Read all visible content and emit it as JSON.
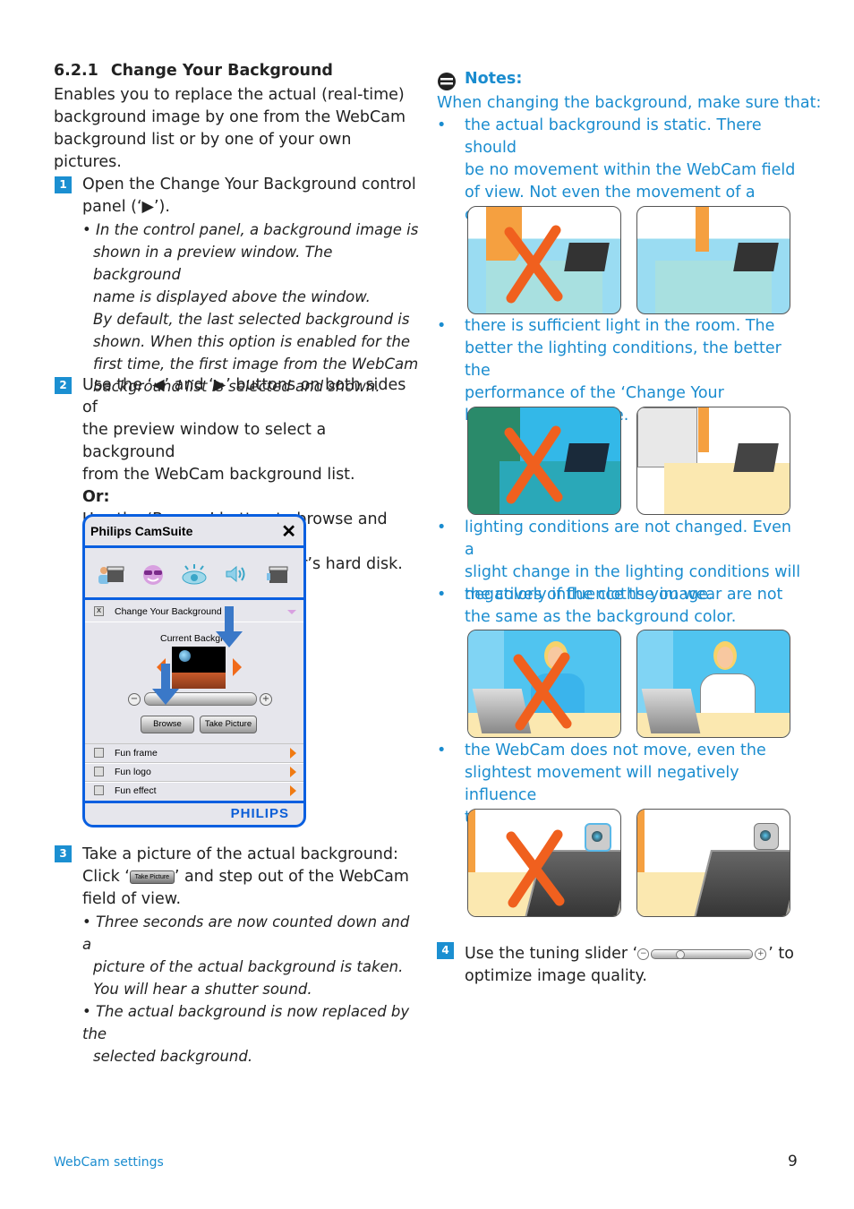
{
  "section": {
    "number": "6.2.1",
    "title": "Change Your Background",
    "intro": [
      "Enables you to replace the actual (real-time)",
      "background image by one from the WebCam",
      "background list or by one of your own pictures."
    ]
  },
  "steps": [
    {
      "number": "1",
      "lines": [
        "Open the Change Your Background control",
        "panel (‘▶’)."
      ],
      "notes": [
        "• In the control panel, a background image is",
        "shown in a preview window. The background",
        "name is displayed above the window.",
        "By default, the last selected background is",
        "shown. When this option is enabled for the",
        "first time, the first image from the WebCam",
        "background list is selected and shown."
      ]
    },
    {
      "number": "2",
      "lines": [
        "Use the ‘◀’ and ‘▶’ buttons on both sides of",
        "the preview window to select a background",
        "from the WebCam background list."
      ],
      "or_label": "Or:",
      "alt_lines": [
        "Use the ‘Browse’ button to browse and load",
        "pictures from your computer’s hard disk."
      ]
    },
    {
      "number": "3",
      "line1": "Take a picture of the actual background:",
      "line2_pre": "Click ‘",
      "line2_btn": "Take Picture",
      "line2_post": "’ and step out of the WebCam",
      "line3": "field of view.",
      "notes": [
        "• Three seconds are now counted down and a",
        "picture of the actual background is taken.",
        "You will hear a shutter sound.",
        "• The actual background is now replaced by the",
        "selected background."
      ]
    },
    {
      "number": "4",
      "pre": "Use the tuning slider ‘",
      "post": "’ to",
      "line2": "optimize image quality.",
      "slider_value_fraction": 0.25
    }
  ],
  "camsuite": {
    "title": "Philips CamSuite",
    "close_icon": "close-icon",
    "toolbar_icons": [
      "background-clapper-icon",
      "sunglasses-face-icon",
      "eye-icon",
      "speaker-icon",
      "clapper-icon"
    ],
    "section_title": "Change Your Background",
    "current_background_label": "Current Backgrou",
    "browse_label": "Browse",
    "take_picture_label": "Take Picture",
    "list": [
      {
        "label": "Fun frame"
      },
      {
        "label": "Fun logo"
      },
      {
        "label": "Fun effect"
      }
    ],
    "brand": "PHILIPS"
  },
  "notes": {
    "title": "Notes:",
    "intro": "When changing the background, make sure that:",
    "items": [
      {
        "lines": [
          "the actual background is static. There should",
          "be no movement within the WebCam field",
          "of view. Not even the movement of a",
          "curtain."
        ]
      },
      {
        "lines": [
          "there is sufficient light in the room. The",
          "better the lighting conditions, the better the",
          "performance of the ‘Change Your",
          "background’ feature."
        ]
      },
      {
        "lines": [
          "lighting conditions are not changed. Even a",
          "slight change in the lighting conditions will",
          "negatively influence the image."
        ]
      },
      {
        "lines": [
          "the colors of the cloths you wear are not",
          "the same as the background color."
        ]
      },
      {
        "lines": [
          "the WebCam does not move, even the",
          "slightest movement will negatively influence",
          "the image."
        ]
      }
    ],
    "bullet": "•"
  },
  "colors": {
    "accent_blue": "#1a8ccf",
    "badge_blue": "#1b8fd1",
    "panel_border": "#0a5fe0",
    "cross_orange": "#f0601e"
  },
  "footer": {
    "section": "WebCam settings",
    "page": "9"
  }
}
